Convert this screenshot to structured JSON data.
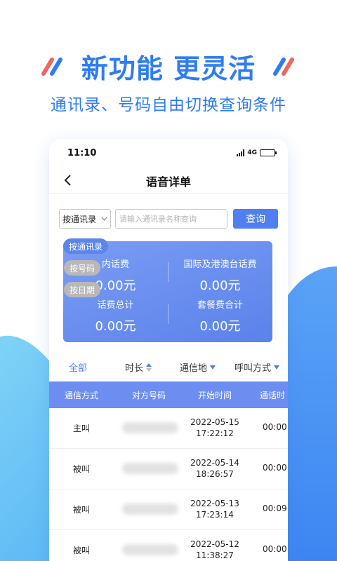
{
  "promo": {
    "title": "新功能 更灵活",
    "subtitle": "通讯录、号码自由切换查询条件"
  },
  "status_bar": {
    "time": "11:10",
    "network": "4G"
  },
  "nav": {
    "back_icon": "chevron-left-icon",
    "title": "语音详单"
  },
  "filter": {
    "selected": "按通讯录",
    "search_placeholder": "请输入通讯录名称查询",
    "query_label": "查询",
    "options": [
      "按通讯录",
      "按号码",
      "按日期"
    ]
  },
  "summary": {
    "domestic_label": "内话费",
    "domestic_value": "0.00元",
    "intl_label": "国际及港澳台话费",
    "intl_value": "0.00元",
    "total_label": "话费总计",
    "total_value": "0.00元",
    "package_label": "套餐费合计",
    "package_value": "0.00元"
  },
  "tabs": {
    "all": "全部",
    "duration": "时长",
    "location": "通信地",
    "call_type": "呼叫方式"
  },
  "table": {
    "headers": [
      "通信方式",
      "对方号码",
      "开始时间",
      "通话时"
    ],
    "rows": [
      {
        "type": "主叫",
        "date": "2022-05-15",
        "time": "17:22:12",
        "duration": "00:00"
      },
      {
        "type": "被叫",
        "date": "2022-05-14",
        "time": "18:26:57",
        "duration": "00:00"
      },
      {
        "type": "被叫",
        "date": "2022-05-13",
        "time": "17:23:14",
        "duration": "00:09"
      },
      {
        "type": "被叫",
        "date": "2022-05-12",
        "time": "11:38:27",
        "duration": "00:00"
      }
    ]
  },
  "colors": {
    "brand_blue": "#2f7cf2",
    "button_blue": "#4f7ff0",
    "card_start": "#7a9cf5",
    "card_end": "#5b82ea",
    "header_blue": "#6d8ef0",
    "accent_red": "#f0675f"
  }
}
